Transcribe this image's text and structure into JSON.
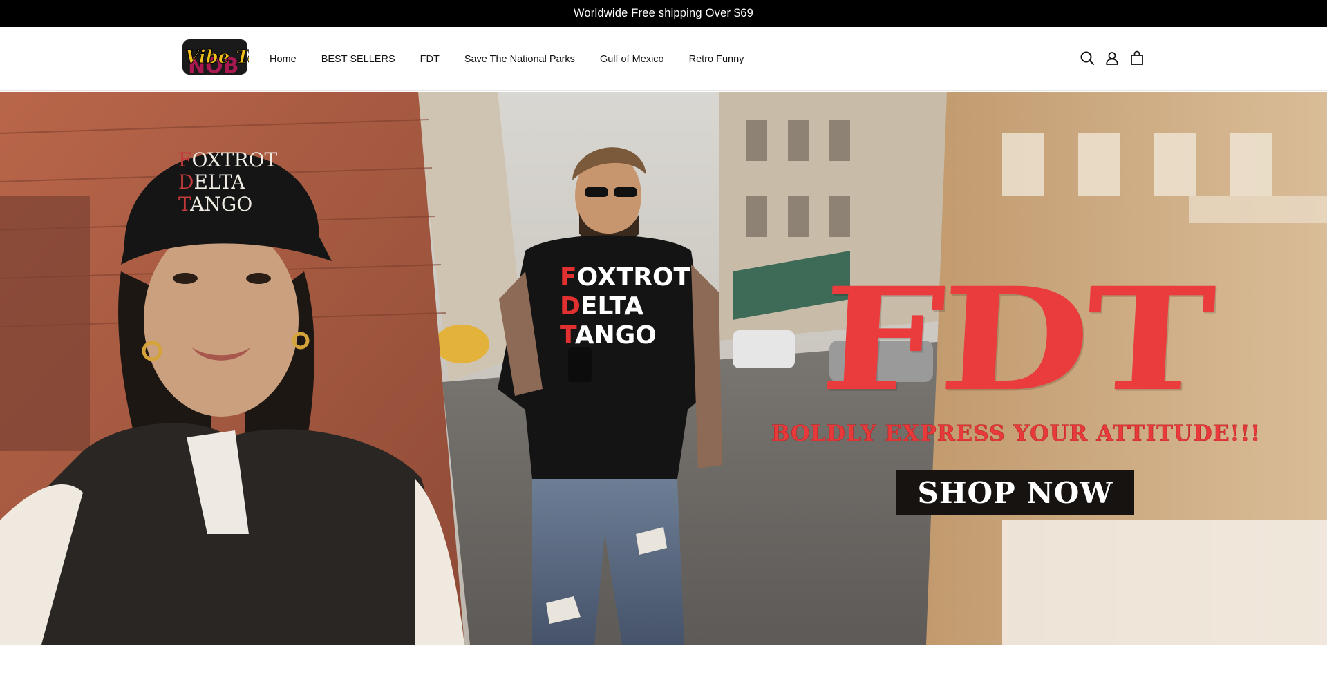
{
  "announcement": {
    "text": "Worldwide Free shipping Over $69"
  },
  "header": {
    "logo_text": "Vibe Tee",
    "nav": [
      {
        "label": "Home"
      },
      {
        "label": "BEST SELLERS"
      },
      {
        "label": "FDT"
      },
      {
        "label": "Save The National Parks"
      },
      {
        "label": "Gulf of Mexico"
      },
      {
        "label": "Retro Funny"
      }
    ],
    "icons": [
      "search-icon",
      "account-icon",
      "cart-icon"
    ]
  },
  "hero": {
    "cap_text_lines": [
      "FOXTROT",
      "DELTA",
      "TANGO"
    ],
    "shirt_text_lines": [
      "FOXTROT",
      "DELTA",
      "TANGO"
    ],
    "title": "FDT",
    "subtitle": "BOLDLY EXPRESS YOUR ATTITUDE!!!",
    "cta_label": "SHOP NOW"
  },
  "colors": {
    "accent_red": "#ea3c3c",
    "announcement_bg": "#000000",
    "cta_bg": "#161310",
    "logo_yellow": "#f2c21b"
  }
}
